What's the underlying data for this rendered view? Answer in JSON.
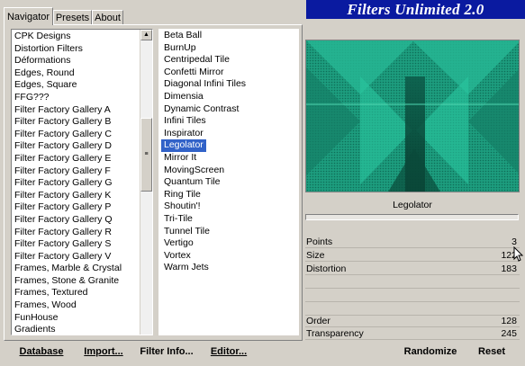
{
  "tabs": [
    "Navigator",
    "Presets",
    "About"
  ],
  "banner_title": "Filters Unlimited 2.0",
  "categories": [
    "CPK Designs",
    "Distortion Filters",
    "Déformations",
    "Edges, Round",
    "Edges, Square",
    "FFG???",
    "Filter Factory Gallery A",
    "Filter Factory Gallery B",
    "Filter Factory Gallery C",
    "Filter Factory Gallery D",
    "Filter Factory Gallery E",
    "Filter Factory Gallery F",
    "Filter Factory Gallery G",
    "Filter Factory Gallery K",
    "Filter Factory Gallery P",
    "Filter Factory Gallery Q",
    "Filter Factory Gallery R",
    "Filter Factory Gallery S",
    "Filter Factory Gallery V",
    "Frames, Marble & Crystal",
    "Frames, Stone & Granite",
    "Frames, Textured",
    "Frames, Wood",
    "FunHouse",
    "Gradients"
  ],
  "filters": [
    "Beta Ball",
    "BurnUp",
    "Centripedal Tile",
    "Confetti Mirror",
    "Diagonal Infini Tiles",
    "Dimensia",
    "Dynamic Contrast",
    "Infini Tiles",
    "Inspirator",
    "Legolator",
    "Mirror It",
    "MovingScreen",
    "Quantum Tile",
    "Ring Tile",
    "Shoutin'!",
    "Tri-Tile",
    "Tunnel Tile",
    "Vertigo",
    "Vortex",
    "Warm Jets"
  ],
  "selected_filter_index": 9,
  "filter_name": "Legolator",
  "params": [
    {
      "label": "Points",
      "value": "3"
    },
    {
      "label": "Size",
      "value": "122"
    },
    {
      "label": "Distortion",
      "value": "183"
    },
    {
      "label": "",
      "value": ""
    },
    {
      "label": "",
      "value": ""
    },
    {
      "label": "",
      "value": ""
    },
    {
      "label": "Order",
      "value": "128"
    },
    {
      "label": "Transparency",
      "value": "245"
    }
  ],
  "buttons": {
    "database": "Database",
    "import": "Import...",
    "filter_info": "Filter Info...",
    "editor": "Editor...",
    "randomize": "Randomize",
    "reset": "Reset"
  },
  "colors": {
    "preview_teal": "#1faa88",
    "selection": "#3162c8",
    "banner": "#0a1aa0"
  }
}
